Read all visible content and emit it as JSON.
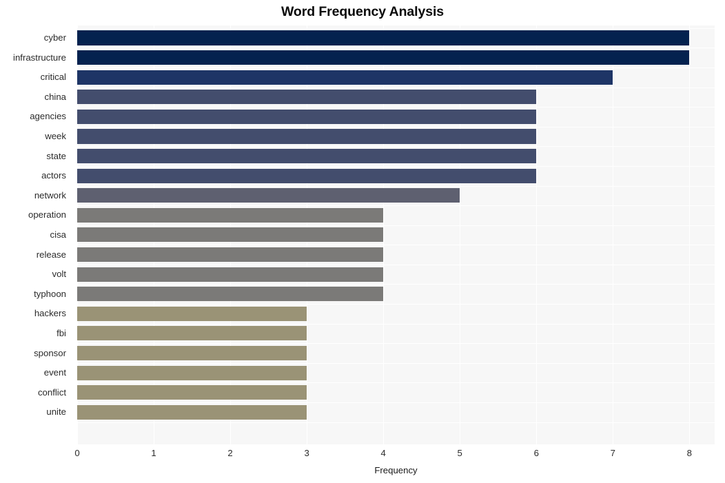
{
  "chart_data": {
    "type": "bar",
    "orientation": "horizontal",
    "title": "Word Frequency Analysis",
    "xlabel": "Frequency",
    "ylabel": "",
    "xlim": [
      0,
      8.33
    ],
    "xticks": [
      0,
      1,
      2,
      3,
      4,
      5,
      6,
      7,
      8
    ],
    "xtick_labels": [
      "0",
      "1",
      "2",
      "3",
      "4",
      "5",
      "6",
      "7",
      "8"
    ],
    "grid": true,
    "legend": false,
    "categories": [
      "cyber",
      "infrastructure",
      "critical",
      "china",
      "agencies",
      "week",
      "state",
      "actors",
      "network",
      "operation",
      "cisa",
      "release",
      "volt",
      "typhoon",
      "hackers",
      "fbi",
      "sponsor",
      "event",
      "conflict",
      "unite"
    ],
    "values": [
      8,
      8,
      7,
      6,
      6,
      6,
      6,
      6,
      5,
      4,
      4,
      4,
      4,
      4,
      3,
      3,
      3,
      3,
      3,
      3
    ],
    "bar_colors": [
      "#04224f",
      "#04224f",
      "#1e3566",
      "#434d6d",
      "#434d6d",
      "#434d6d",
      "#434d6d",
      "#434d6d",
      "#5e6070",
      "#7b7a78",
      "#7b7a78",
      "#7b7a78",
      "#7b7a78",
      "#7b7a78",
      "#9a9376",
      "#9a9376",
      "#9a9376",
      "#9a9376",
      "#9a9376",
      "#9a9376"
    ],
    "plot_background": "#f7f7f7",
    "grid_color": "#ffffff",
    "figure_background": "#ffffff"
  }
}
